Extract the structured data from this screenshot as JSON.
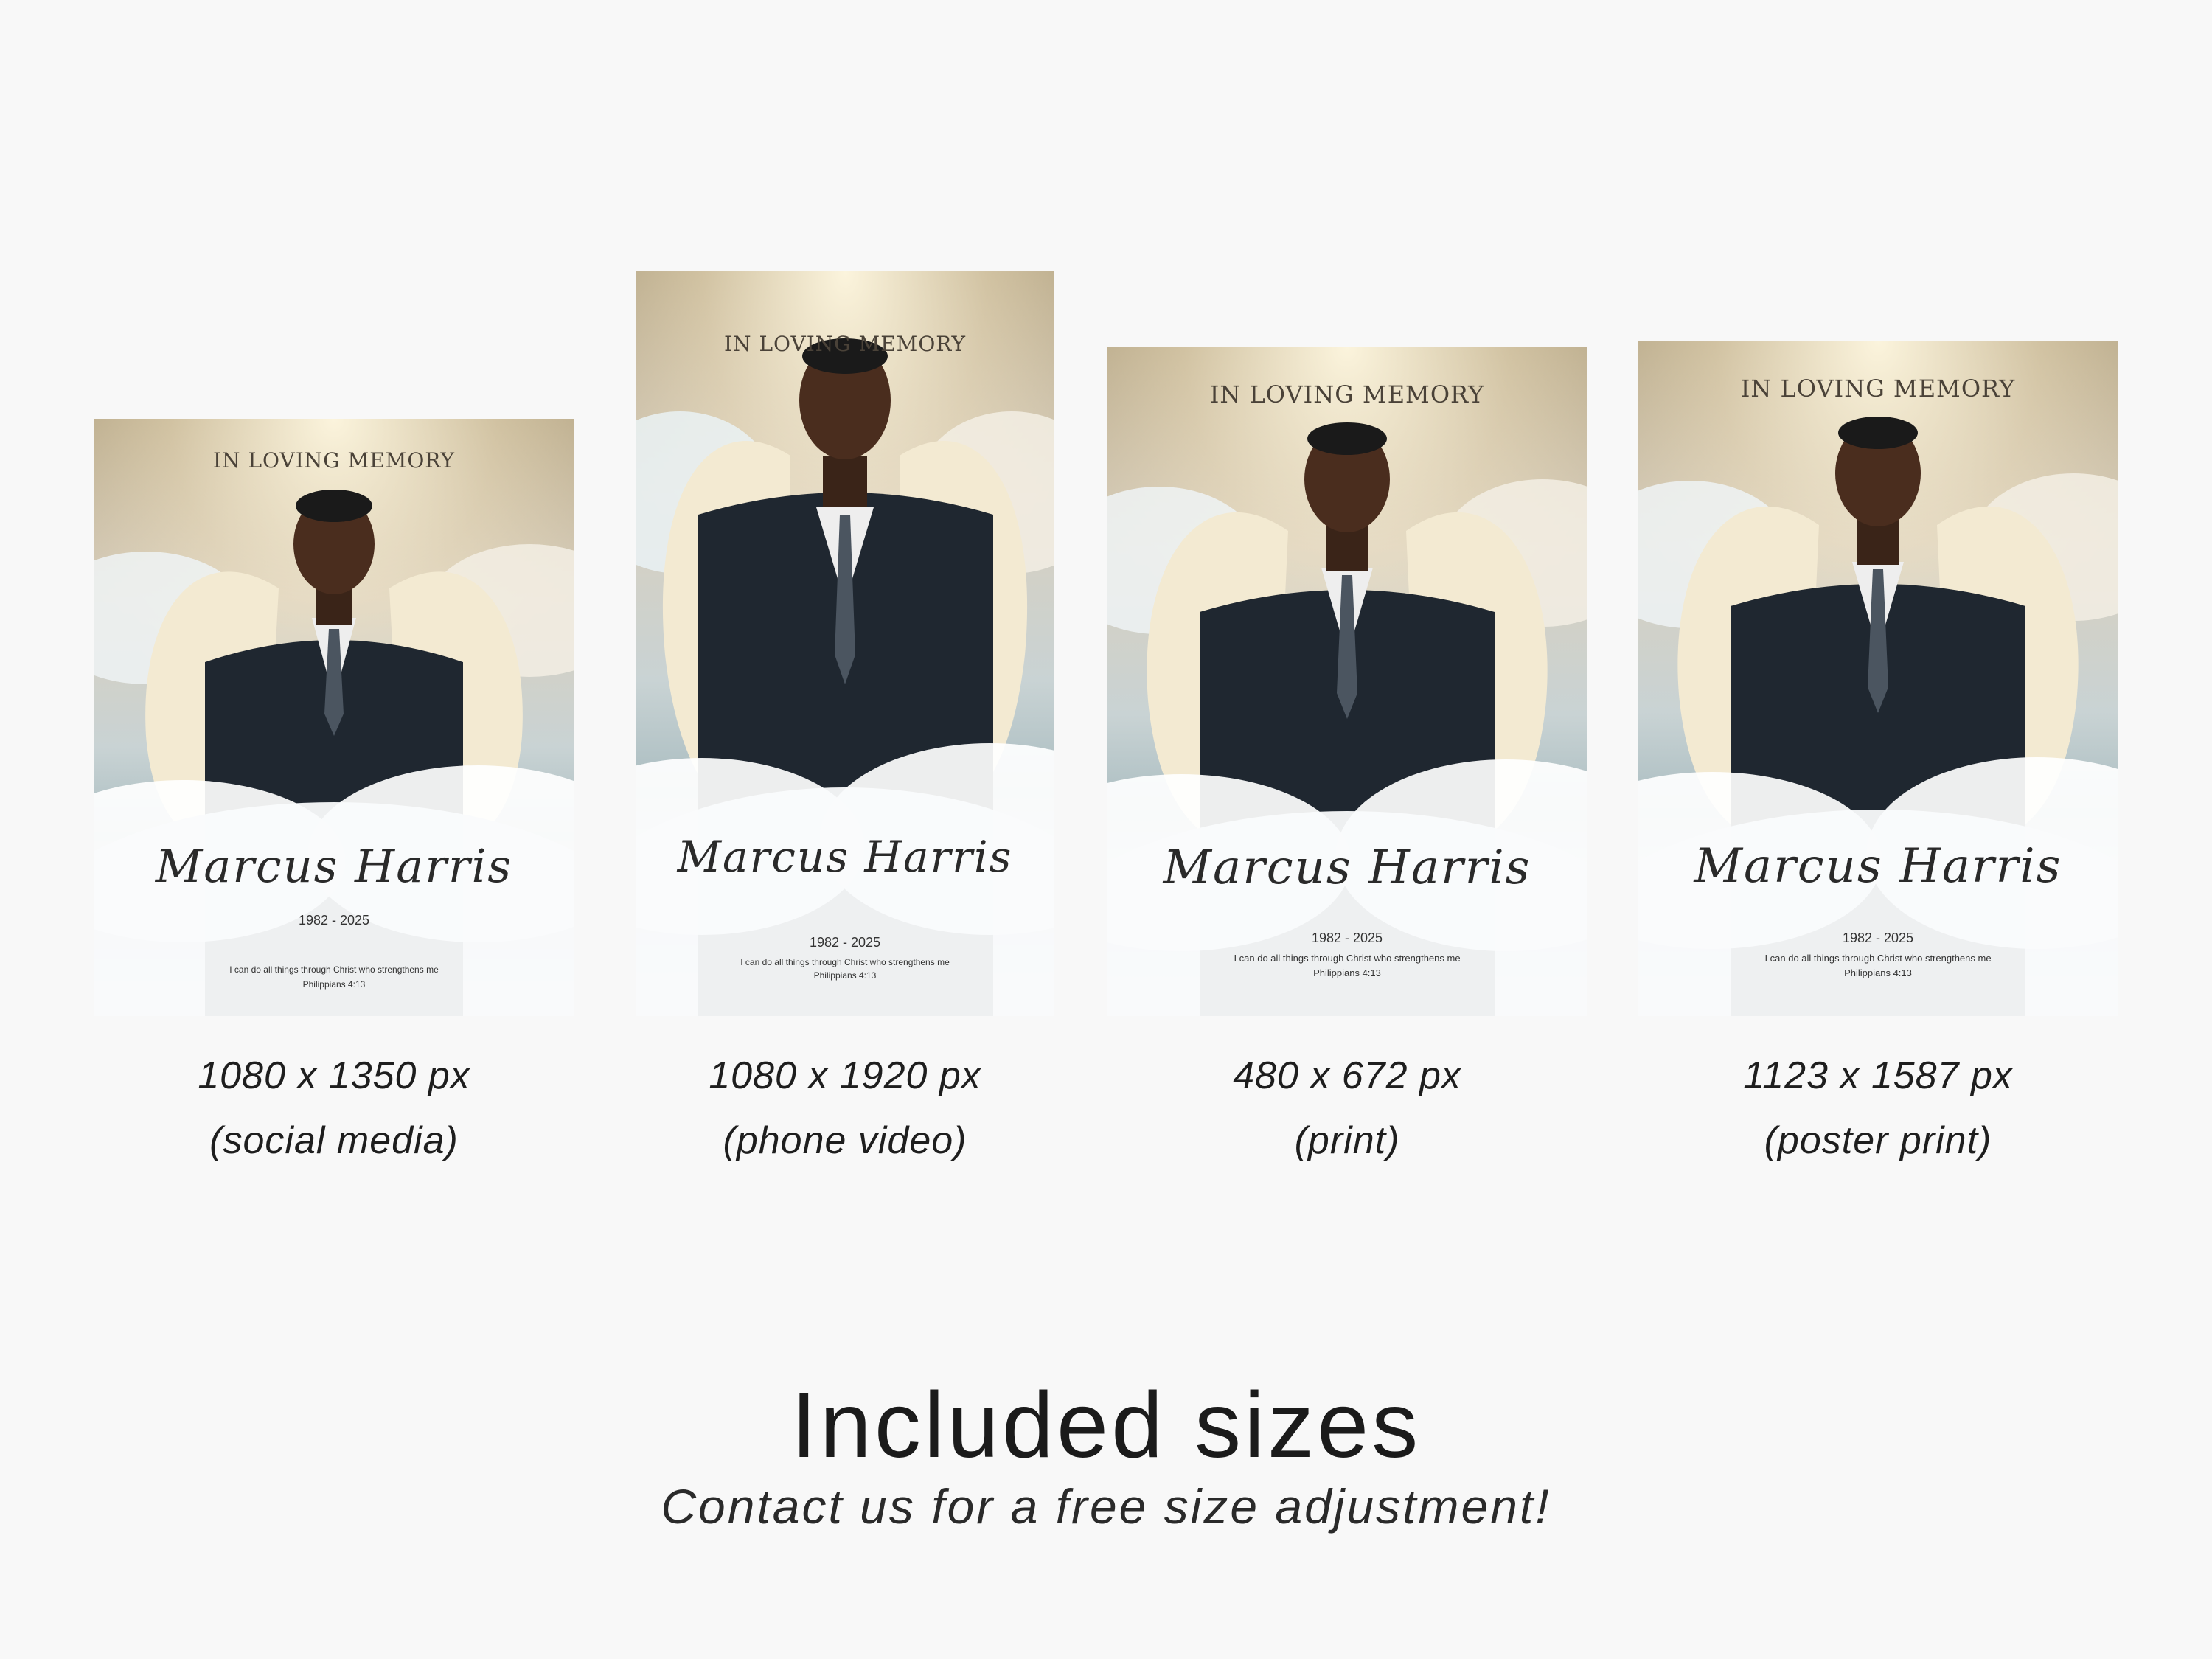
{
  "cards": [
    {
      "title": "IN LOVING MEMORY",
      "name": "Marcus Harris",
      "years": "1982 - 2025",
      "verse": "I can do all things through Christ who strengthens me",
      "reference": "Philippians 4:13",
      "size": "1080 x 1350 px",
      "usage": "(social media)"
    },
    {
      "title": "IN LOVING MEMORY",
      "name": "Marcus Harris",
      "years": "1982 - 2025",
      "verse": "I can do all things through Christ who strengthens me",
      "reference": "Philippians 4:13",
      "size": "1080 x 1920 px",
      "usage": "(phone video)"
    },
    {
      "title": "IN LOVING MEMORY",
      "name": "Marcus Harris",
      "years": "1982 - 2025",
      "verse": "I can do all things through Christ who strengthens me",
      "reference": "Philippians 4:13",
      "size": "480 x 672 px",
      "usage": "(print)"
    },
    {
      "title": "IN LOVING MEMORY",
      "name": "Marcus Harris",
      "years": "1982 - 2025",
      "verse": "I can do all things through Christ who strengthens me",
      "reference": "Philippians 4:13",
      "size": "1123 x 1587 px",
      "usage": "(poster print)"
    }
  ],
  "headline": "Included sizes",
  "subline": "Contact us for a free size adjustment!"
}
